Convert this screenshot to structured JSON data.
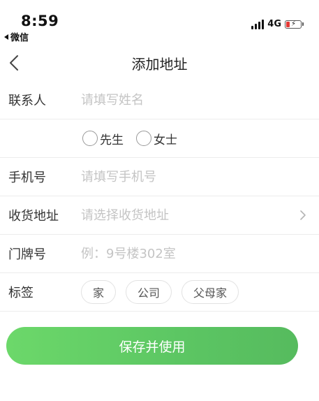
{
  "status_bar": {
    "time": "8:59",
    "back_app": "微信",
    "network": "4G",
    "icons": {
      "signal": "signal-bars-icon",
      "battery": "battery-charging-icon"
    },
    "battery_color": "#e53935"
  },
  "nav": {
    "title": "添加地址",
    "back_icon": "chevron-left-icon"
  },
  "form": {
    "contact": {
      "label": "联系人",
      "placeholder": "请填写姓名"
    },
    "gender": {
      "options": [
        "先生",
        "女士"
      ]
    },
    "phone": {
      "label": "手机号",
      "placeholder": "请填写手机号"
    },
    "address": {
      "label": "收货地址",
      "placeholder": "请选择收货地址",
      "arrow_icon": "chevron-right-icon"
    },
    "door": {
      "label": "门牌号",
      "placeholder": "例：9号楼302室"
    },
    "tags": {
      "label": "标签",
      "options": [
        "家",
        "公司",
        "父母家"
      ]
    }
  },
  "save_button": {
    "label": "保存并使用",
    "color": "#5cc663"
  }
}
